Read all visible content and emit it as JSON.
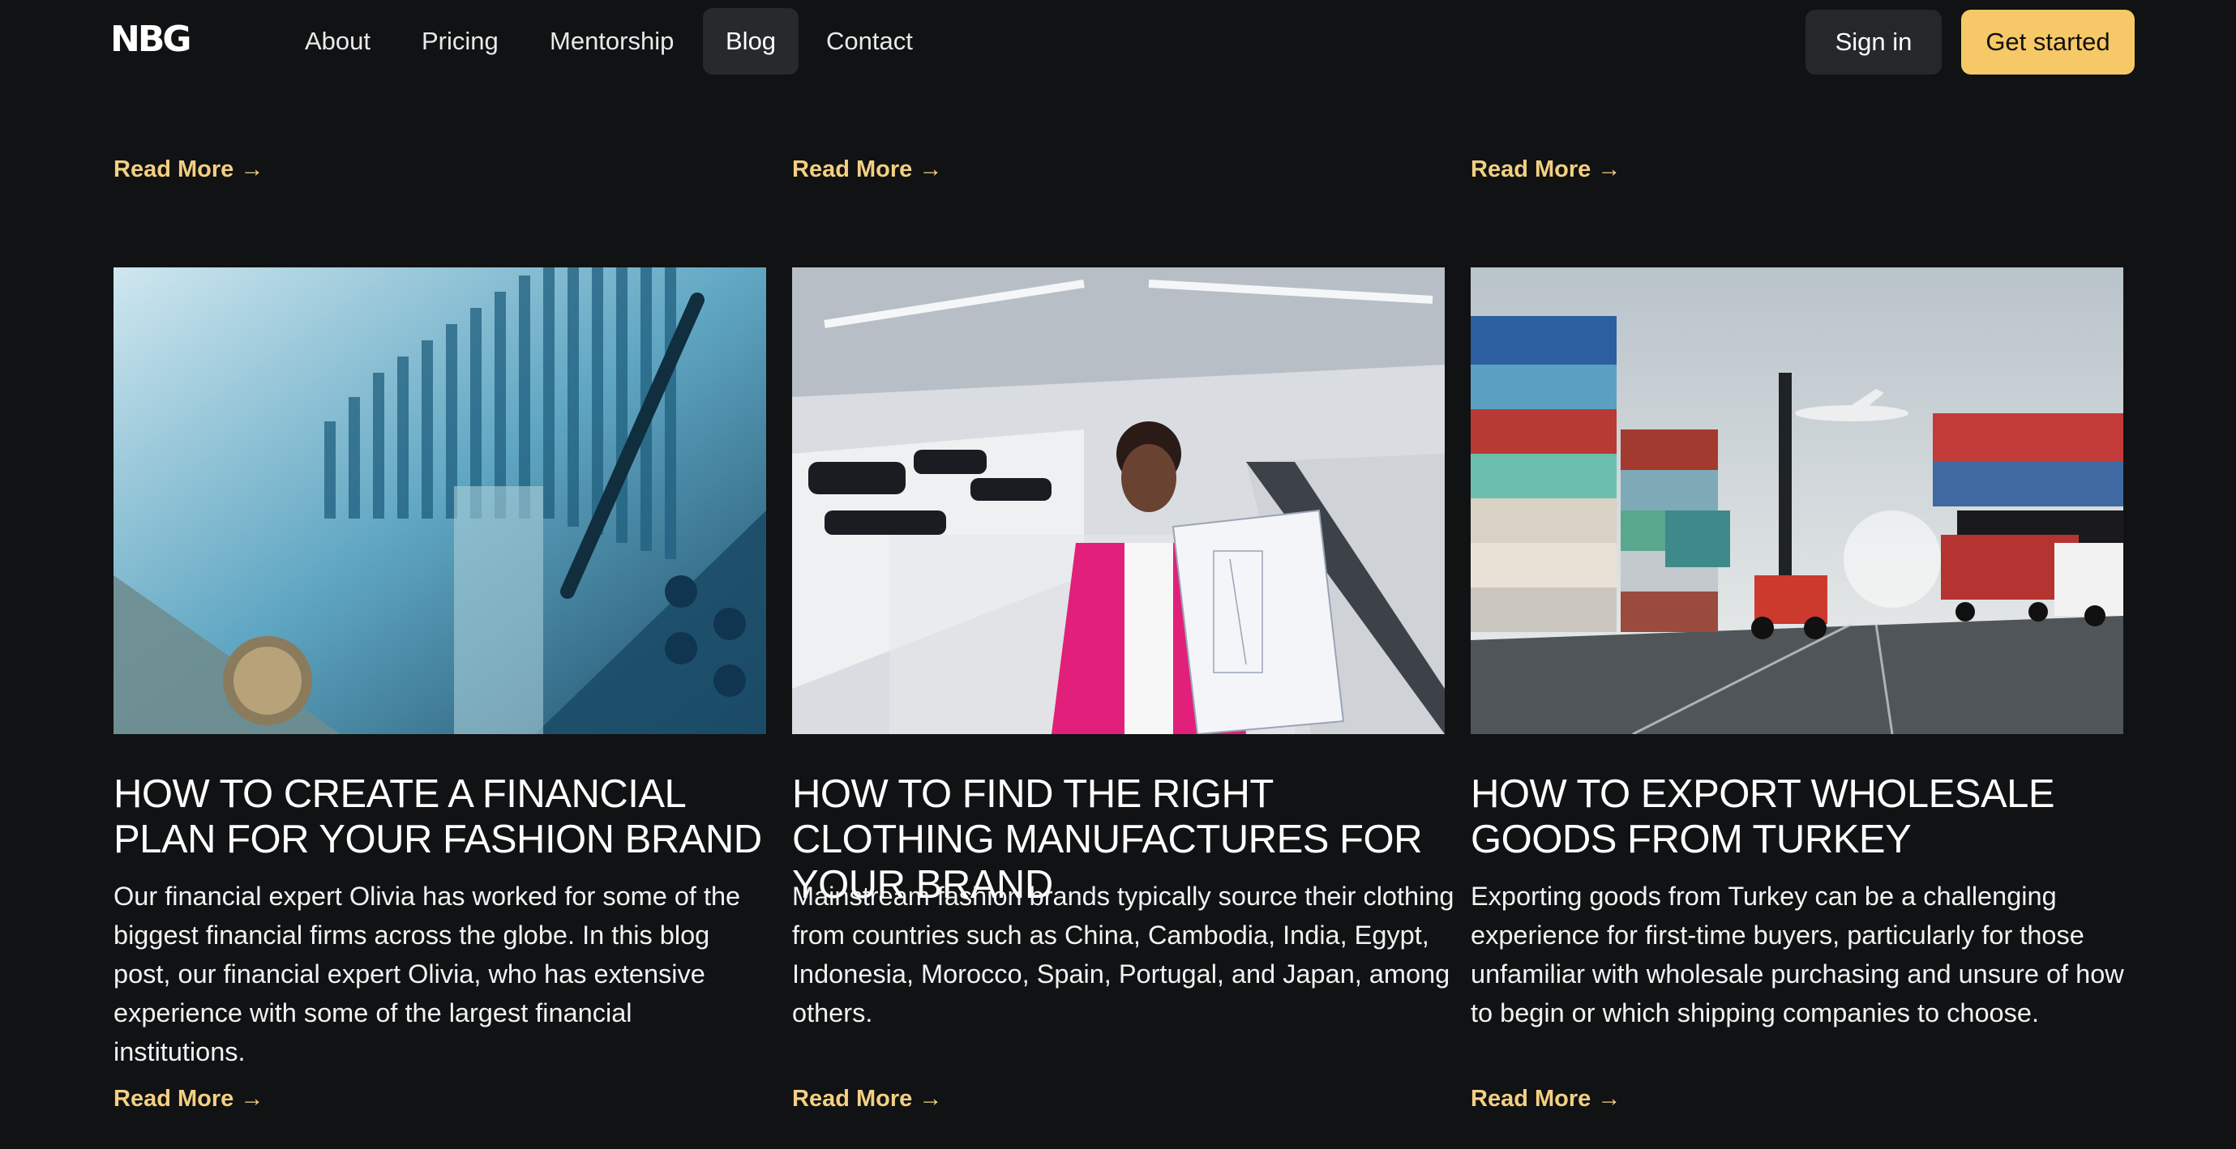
{
  "header": {
    "logo_text": "NBG",
    "nav": [
      {
        "label": "About"
      },
      {
        "label": "Pricing"
      },
      {
        "label": "Mentorship"
      },
      {
        "label": "Blog",
        "active": true
      },
      {
        "label": "Contact"
      }
    ],
    "signin_label": "Sign in",
    "get_started_label": "Get started"
  },
  "colors": {
    "background": "#101213",
    "accent": "#f7c867",
    "read_more": "#f3cf82"
  },
  "top_row": {
    "read_more_labels": [
      "Read More →",
      "Read More →",
      "Read More →"
    ]
  },
  "posts": [
    {
      "title": "HOW TO CREATE A FINANCIAL PLAN FOR YOUR FASHION BRAND",
      "description": "Our financial expert Olivia has worked for some of the biggest financial firms across the globe. In this blog post, our financial expert Olivia, who has extensive experience with some of the largest financial institutions.",
      "read_more": "Read More →",
      "image_icon": "finance-charts-image"
    },
    {
      "title": "HOW TO FIND THE RIGHT CLOTHING MANUFACTURES FOR YOUR BRAND",
      "description": "Mainstream fashion brands typically source their clothing from countries such as China, Cambodia, India, Egypt, Indonesia, Morocco, Spain, Portugal, and Japan, among others.",
      "read_more": "Read More →",
      "image_icon": "clothing-factory-image"
    },
    {
      "title": "HOW TO EXPORT WHOLESALE GOODS FROM TURKEY",
      "description": "Exporting goods from Turkey can be a challenging experience for first-time buyers, particularly for those unfamiliar with wholesale purchasing and unsure of how to begin or which shipping companies to choose.",
      "read_more": "Read More →",
      "image_icon": "shipping-containers-image"
    }
  ]
}
